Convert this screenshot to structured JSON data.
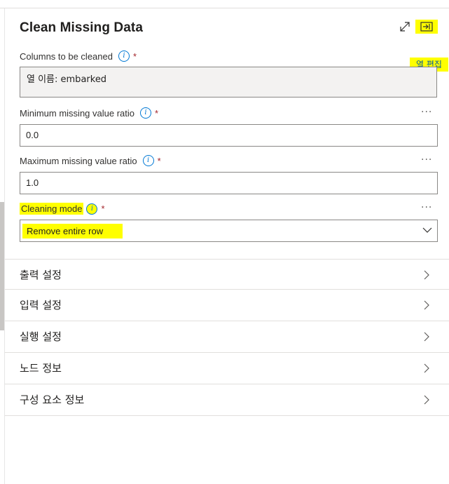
{
  "panel": {
    "title": "Clean Missing Data",
    "expand_icon": "expand-diagonal-icon",
    "collapse_icon": "panel-collapse-icon"
  },
  "columns": {
    "label": "Columns to be cleaned",
    "required_mark": "*",
    "edit_link": "열 편집",
    "value": "열 이름: embarked"
  },
  "min_ratio": {
    "label": "Minimum missing value ratio",
    "required_mark": "*",
    "value": "0.0",
    "more": "···"
  },
  "max_ratio": {
    "label": "Maximum missing value ratio",
    "required_mark": "*",
    "value": "1.0",
    "more": "···"
  },
  "cleaning_mode": {
    "label": "Cleaning mode",
    "required_mark": "*",
    "selected": "Remove entire row",
    "more": "···"
  },
  "sections": [
    {
      "label": "출력 설정"
    },
    {
      "label": "입력 설정"
    },
    {
      "label": "실행 설정"
    },
    {
      "label": "노드 정보"
    },
    {
      "label": "구성 요소 정보"
    }
  ],
  "colors": {
    "highlight": "#ffff00",
    "accent": "#0078d4",
    "required": "#a4262c"
  }
}
